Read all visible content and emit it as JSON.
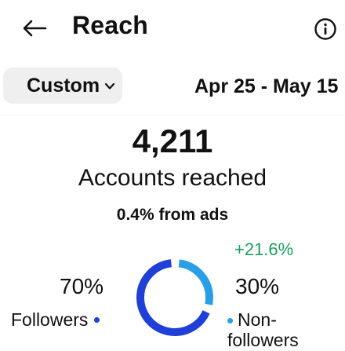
{
  "header": {
    "title": "Reach",
    "back_icon": "arrow-left-icon",
    "info_icon": "info-circle-icon"
  },
  "filter": {
    "selected": "Custom",
    "date_range": "Apr 25 - May 15"
  },
  "metric": {
    "value": "4,211",
    "label": "Accounts reached",
    "ads_note": "0.4% from ads"
  },
  "breakdown": {
    "change": "+21.6%",
    "followers": {
      "percent_label": "70%",
      "label": "Followers",
      "share": 0.7,
      "color": "#1f3fd6"
    },
    "non_followers": {
      "percent_label": "30%",
      "label": "Non-followers",
      "share": 0.3,
      "color": "#2a9fe8"
    }
  },
  "colors": {
    "accent_green": "#1a9e5a",
    "donut_dark": "#0b1a3a"
  }
}
